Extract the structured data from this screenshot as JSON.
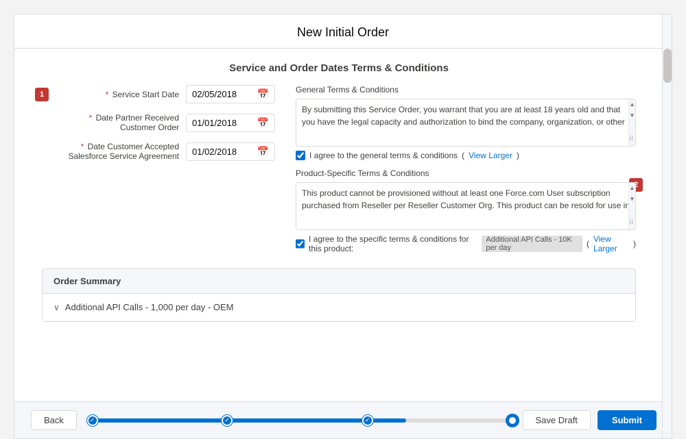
{
  "modal": {
    "title": "New Initial Order"
  },
  "section": {
    "heading": "Service and Order Dates Terms & Conditions"
  },
  "form": {
    "fields": [
      {
        "label": "Service Start Date",
        "required": true,
        "value": "02/05/2018",
        "badge": "1"
      },
      {
        "label": "Date Partner Received Customer Order",
        "required": true,
        "value": "01/01/2018",
        "badge": null
      },
      {
        "label": "Date Customer Accepted Salesforce Service Agreement",
        "required": true,
        "value": "01/02/2018",
        "badge": null
      }
    ]
  },
  "terms": {
    "general_label": "General Terms & Conditions",
    "general_text": "By submitting this Service Order, you warrant that you are at least 18 years old and that you have the legal capacity and authorization to bind the company, organization, or other",
    "general_agree": "I agree to the general terms & conditions",
    "general_view_larger": "View Larger",
    "product_label": "Product-Specific Terms & Conditions",
    "product_text": "This product cannot be provisioned without at least one Force.com User subscription purchased from Reseller per Reseller Customer Org. This product can be resold for use in",
    "product_agree": "I agree to the specific terms & conditions for this product:",
    "product_name": "Additional API Calls - 10K per day",
    "product_view_larger": "View Larger",
    "badge": "2"
  },
  "order_summary": {
    "header": "Order Summary",
    "row_label": "Additional API Calls - 1,000 per day - OEM"
  },
  "footer": {
    "back_label": "Back",
    "save_draft_label": "Save Draft",
    "submit_label": "Submit",
    "progress": {
      "steps": 4,
      "completed": 3,
      "active": 3
    }
  }
}
